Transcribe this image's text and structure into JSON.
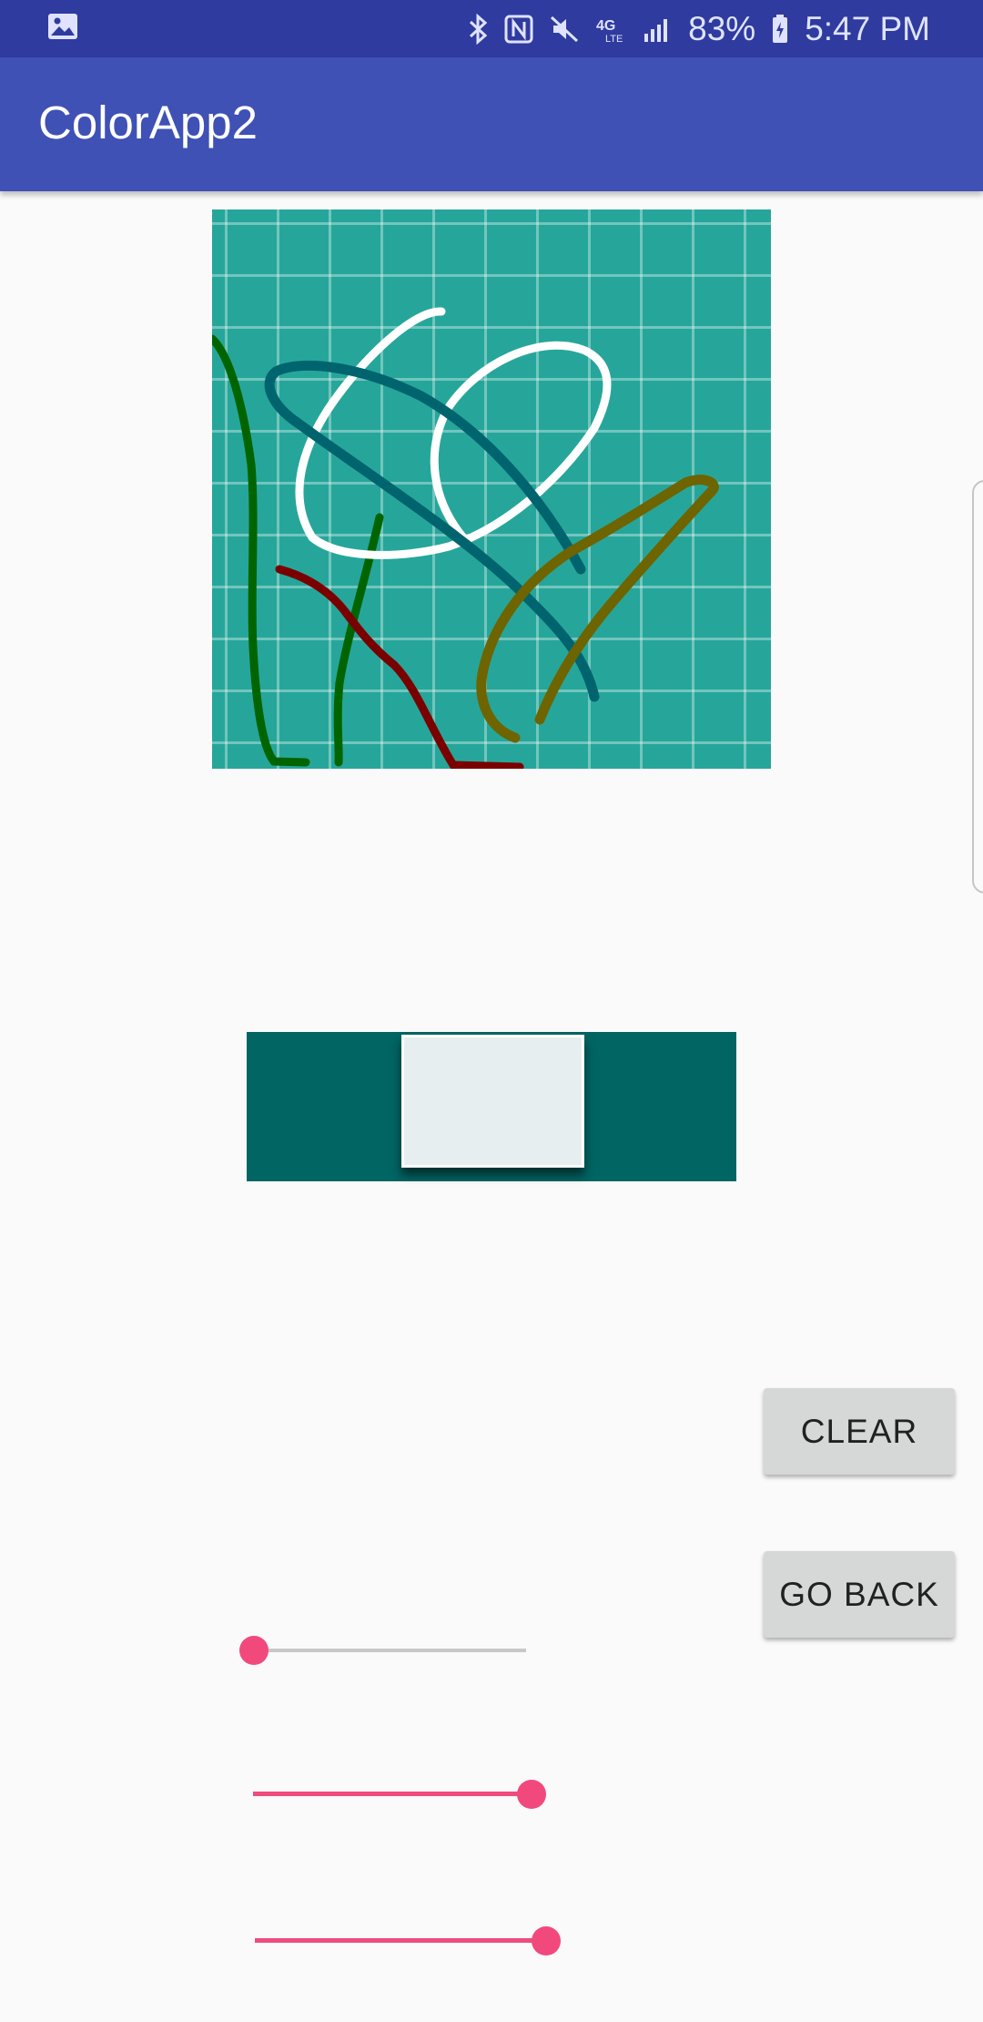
{
  "status_bar": {
    "battery": "83%",
    "time": "5:47 PM",
    "icons": [
      "image-icon",
      "bluetooth-icon",
      "nfc-icon",
      "mute-icon",
      "4g-lte-icon",
      "signal-icon",
      "battery-charging-icon"
    ]
  },
  "app_bar": {
    "title": "ColorApp2",
    "color": "#3f51b5"
  },
  "canvas": {
    "background_color": "#26a69a",
    "grid_color": "#ffffff",
    "stroke_colors": [
      "#006400",
      "#ffffff",
      "#00646e",
      "#7a0000",
      "#6e6400"
    ]
  },
  "preview": {
    "background_color": "#006563",
    "swatch_color": "#e6eeef"
  },
  "buttons": {
    "clear_label": "CLEAR",
    "go_back_label": "GO BACK"
  },
  "sliders": [
    {
      "name": "slider-1",
      "value_fraction": 0.0
    },
    {
      "name": "slider-2",
      "value_fraction": 1.0
    },
    {
      "name": "slider-3",
      "value_fraction": 1.0
    }
  ],
  "accent_color": "#f2497c"
}
